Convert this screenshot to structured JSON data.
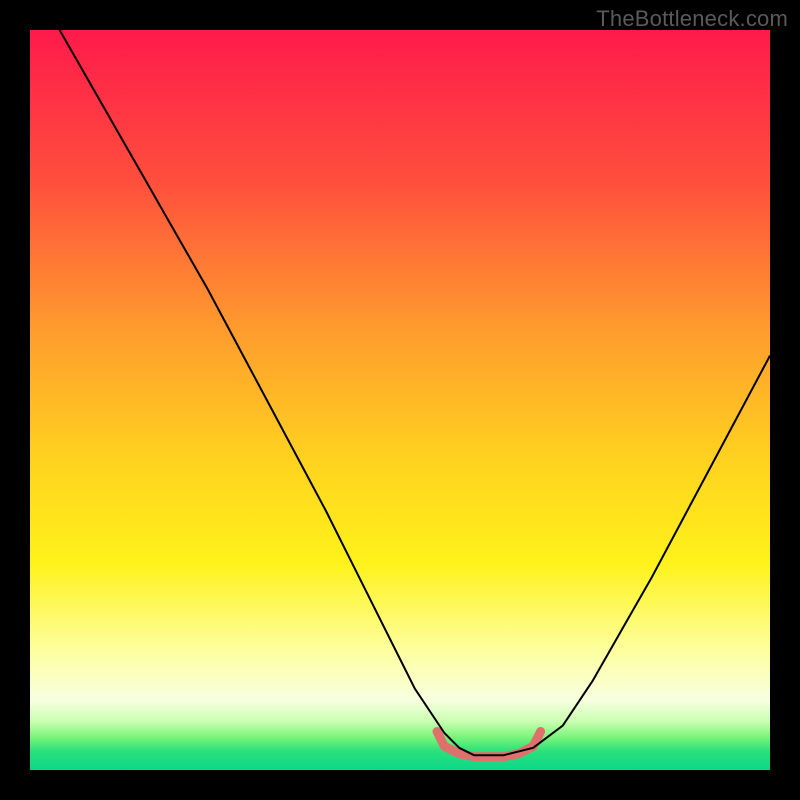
{
  "watermark": "TheBottleneck.com",
  "chart_data": {
    "type": "line",
    "title": "",
    "xlabel": "",
    "ylabel": "",
    "xlim": [
      0,
      100
    ],
    "ylim": [
      0,
      100
    ],
    "grid": false,
    "legend": false,
    "gradient_stops": [
      {
        "offset": 0,
        "color": "#ff1a4b"
      },
      {
        "offset": 0.2,
        "color": "#ff4d3d"
      },
      {
        "offset": 0.4,
        "color": "#ff9a2e"
      },
      {
        "offset": 0.58,
        "color": "#ffd21f"
      },
      {
        "offset": 0.72,
        "color": "#fff21a"
      },
      {
        "offset": 0.84,
        "color": "#fdffa0"
      },
      {
        "offset": 0.905,
        "color": "#f8ffe0"
      },
      {
        "offset": 0.935,
        "color": "#c8ffb0"
      },
      {
        "offset": 0.955,
        "color": "#7cf57c"
      },
      {
        "offset": 0.975,
        "color": "#29e07a"
      },
      {
        "offset": 1.0,
        "color": "#0cd88a"
      }
    ],
    "series": [
      {
        "name": "bottleneck-curve",
        "stroke": "#000000",
        "stroke_width": 2,
        "x": [
          4,
          8,
          12,
          16,
          20,
          24,
          28,
          32,
          36,
          40,
          44,
          48,
          50,
          52,
          56,
          58,
          60,
          62,
          64,
          68,
          72,
          76,
          80,
          84,
          88,
          92,
          96,
          100
        ],
        "y": [
          100,
          93,
          86,
          79,
          72,
          65,
          57.5,
          50,
          42.5,
          35,
          27,
          19,
          15,
          11,
          5,
          3,
          2,
          2,
          2,
          3,
          6,
          12,
          19,
          26,
          33.5,
          41,
          48.5,
          56
        ]
      },
      {
        "name": "optimal-zone-marker",
        "stroke": "#e0706b",
        "stroke_width": 9,
        "linecap": "round",
        "x": [
          55,
          56,
          58,
          60,
          62,
          64,
          66,
          68,
          69
        ],
        "y": [
          5.2,
          3.2,
          2.2,
          1.8,
          1.8,
          1.8,
          2.2,
          3.2,
          5.2
        ]
      }
    ]
  }
}
